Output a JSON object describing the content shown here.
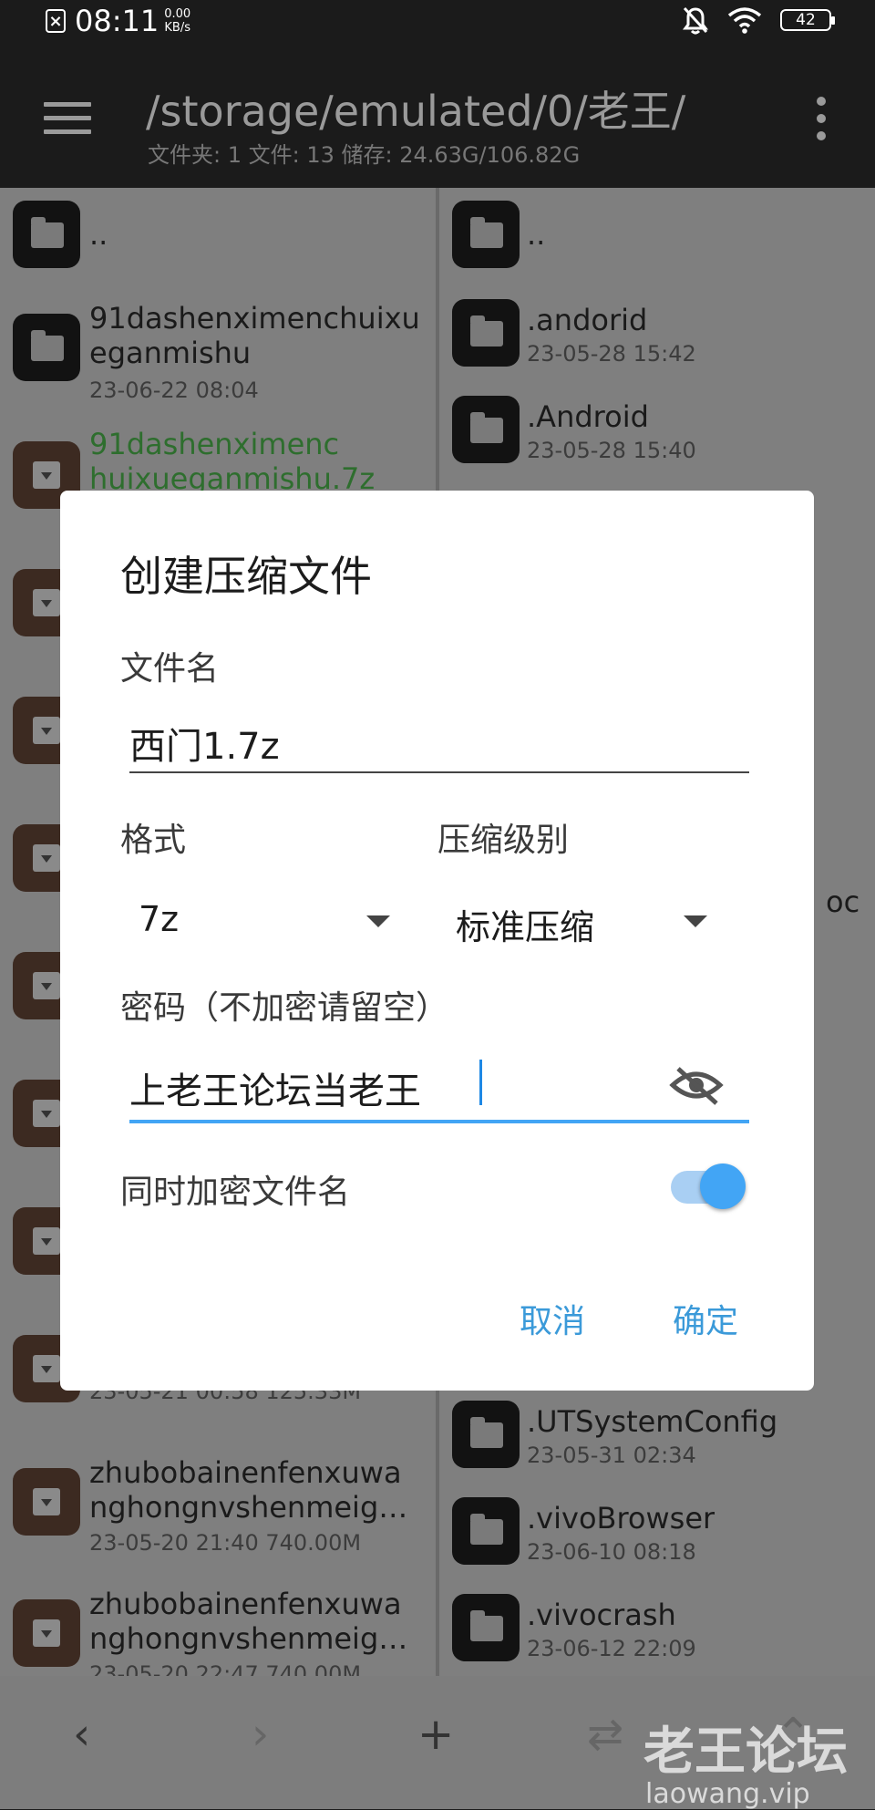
{
  "status_bar": {
    "notif_icon": "x-box-icon",
    "time": "08:11",
    "speed_value": "0.00",
    "speed_unit": "KB/s",
    "battery": "42"
  },
  "app_bar": {
    "path": "/storage/emulated/0/老王/",
    "summary": "文件夹: 1  文件: 13  储存: 24.63G/106.82G"
  },
  "left_pane": {
    "parent_label": "..",
    "items": [
      {
        "name_line1": "91dashenximenchuixu",
        "name_line2": "eganmishu",
        "meta": "23-06-22 08:04"
      },
      {
        "name_line1": "91dashenximenc",
        "name_line2": "huixueganmishu.7z"
      },
      {
        "name_line1": "",
        "meta": "23-05-21 00:58  125.33M"
      },
      {
        "name_line1": "zhubobainenfenxuwa",
        "name_line2": "nghongnvshenmeig…",
        "meta": "23-05-20 21:40  740.00M"
      },
      {
        "name_line1": "zhubobainenfenxuwa",
        "name_line2": "nghongnvshenmeig…",
        "meta": "23-05-20 22:47  740.00M"
      }
    ]
  },
  "right_pane": {
    "parent_label": "..",
    "items": [
      {
        "name": ".andorid",
        "meta": "23-05-28 15:42"
      },
      {
        "name": ".Android",
        "meta": "23-05-28 15:40"
      },
      {
        "name": ".UTSystemConfig",
        "meta": "23-05-31 02:34"
      },
      {
        "name": ".vivoBrowser",
        "meta": "23-06-10 08:18"
      },
      {
        "name": ".vivocrash",
        "meta": "23-06-12 22:09"
      }
    ],
    "partial_text": "oc"
  },
  "dialog": {
    "title": "创建压缩文件",
    "filename_label": "文件名",
    "filename_value": "西门1.7z",
    "format_label": "格式",
    "format_value": "7z",
    "level_label": "压缩级别",
    "level_value": "标准压缩",
    "password_label": "密码（不加密请留空）",
    "password_value": "上老王论坛当老王",
    "encrypt_names_label": "同时加密文件名",
    "encrypt_names_on": true,
    "cancel": "取消",
    "confirm": "确定",
    "accent_color": "#42a5f5"
  },
  "bottom_bar": {
    "back": "‹",
    "forward": "›",
    "add": "+",
    "swap": "⇄",
    "up": "⌃"
  },
  "watermark": {
    "text": "老王论坛",
    "url": "laowang.vip"
  }
}
